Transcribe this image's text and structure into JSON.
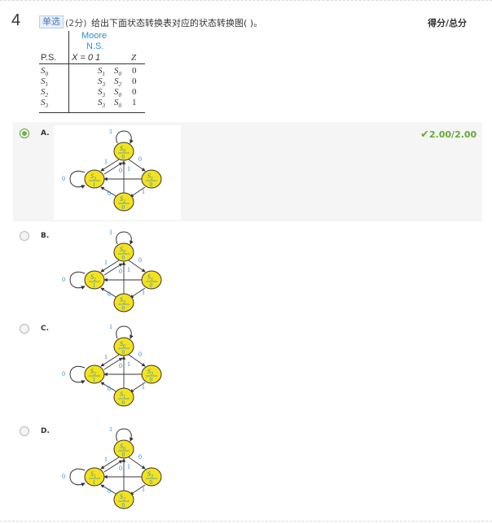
{
  "question": {
    "number": "4",
    "type_badge": "单选",
    "points": "(2分)",
    "text": "给出下面状态转换表对应的状态转换图(   )。",
    "score_header": "得分/总分"
  },
  "state_table": {
    "title": "Moore",
    "subtitle": "N.S.",
    "ps_header": "P.S.",
    "x_header": "X =  0   1",
    "z_header": "Z",
    "rows": [
      {
        "ps": "S0",
        "ns0": "S1",
        "ns1": "S0",
        "z": "0"
      },
      {
        "ps": "S1",
        "ns0": "S3",
        "ns1": "S2",
        "z": "0"
      },
      {
        "ps": "S2",
        "ns0": "S3",
        "ns1": "S0",
        "z": "0"
      },
      {
        "ps": "S3",
        "ns0": "S3",
        "ns1": "S0",
        "z": "1"
      }
    ]
  },
  "options": [
    {
      "label": "A.",
      "selected": true,
      "result": "2.00/2.00",
      "states": {
        "top": "S0",
        "left": "S3",
        "right": "S1",
        "bottom": "S2"
      },
      "outputs": {
        "top": "0",
        "left": "1",
        "right": "0",
        "bottom": "0"
      }
    },
    {
      "label": "B.",
      "selected": false,
      "states": {
        "top": "S0",
        "left": "S2",
        "right": "S1",
        "bottom": "S3"
      },
      "outputs": {
        "top": "0",
        "left": "1",
        "right": "0",
        "bottom": "0"
      }
    },
    {
      "label": "C.",
      "selected": false,
      "states": {
        "top": "S0",
        "left": "S2",
        "right": "S3",
        "bottom": "S1"
      },
      "outputs": {
        "top": "0",
        "left": "1",
        "right": "0",
        "bottom": "0"
      }
    },
    {
      "label": "D.",
      "selected": false,
      "states": {
        "top": "S0",
        "left": "S1",
        "right": "S3",
        "bottom": "S2"
      },
      "outputs": {
        "top": "0",
        "left": "1",
        "right": "0",
        "bottom": "0"
      }
    }
  ],
  "colors": {
    "state_fill": "#f5e21c",
    "label_blue": "#2a8fd0",
    "correct_green": "#6aa837"
  }
}
